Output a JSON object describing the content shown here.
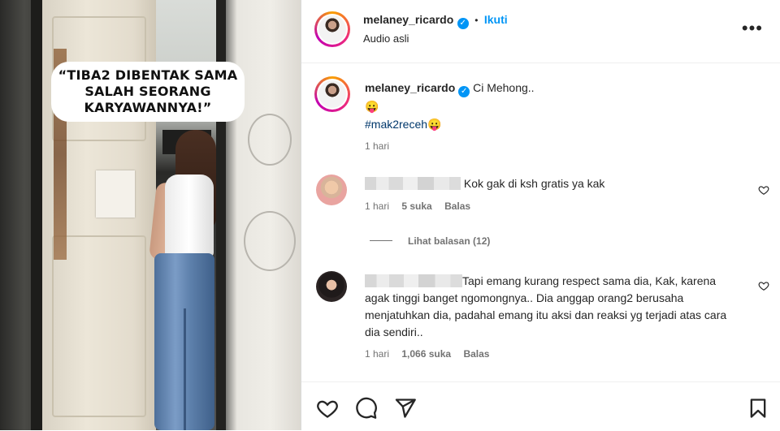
{
  "media": {
    "caption": "“TIBA2 DIBENTAK SAMA SALAH SEORANG KARYAWANNYA!”"
  },
  "header": {
    "username": "melaney_ricardo",
    "separator": "•",
    "follow_label": "Ikuti",
    "audio": "Audio asli",
    "more_icon": "more-options-icon"
  },
  "post": {
    "username": "melaney_ricardo",
    "caption_text": "Ci Mehong..",
    "emoji": "😛",
    "hashtag": "#mak2receh",
    "hashtag_emoji": "😛",
    "time": "1 hari"
  },
  "comments": [
    {
      "text": "Kok gak di ksh gratis ya kak",
      "time": "1 hari",
      "likes": "5 suka",
      "reply": "Balas",
      "view_replies": "Lihat balasan (12)"
    },
    {
      "text": "Tapi emang kurang respect sama dia, Kak, karena agak tinggi banget ngomongnya.. Dia anggap orang2 berusaha menjatuhkan dia, padahal emang itu aksi dan reaksi yg terjadi atas cara dia sendiri..",
      "time": "1 hari",
      "likes": "1,066 suka",
      "reply": "Balas"
    }
  ],
  "actions": [
    "like-icon",
    "comment-icon",
    "share-icon",
    "save-icon"
  ],
  "colors": {
    "accent": "#0095f6",
    "text": "#262626",
    "muted": "#737373"
  }
}
